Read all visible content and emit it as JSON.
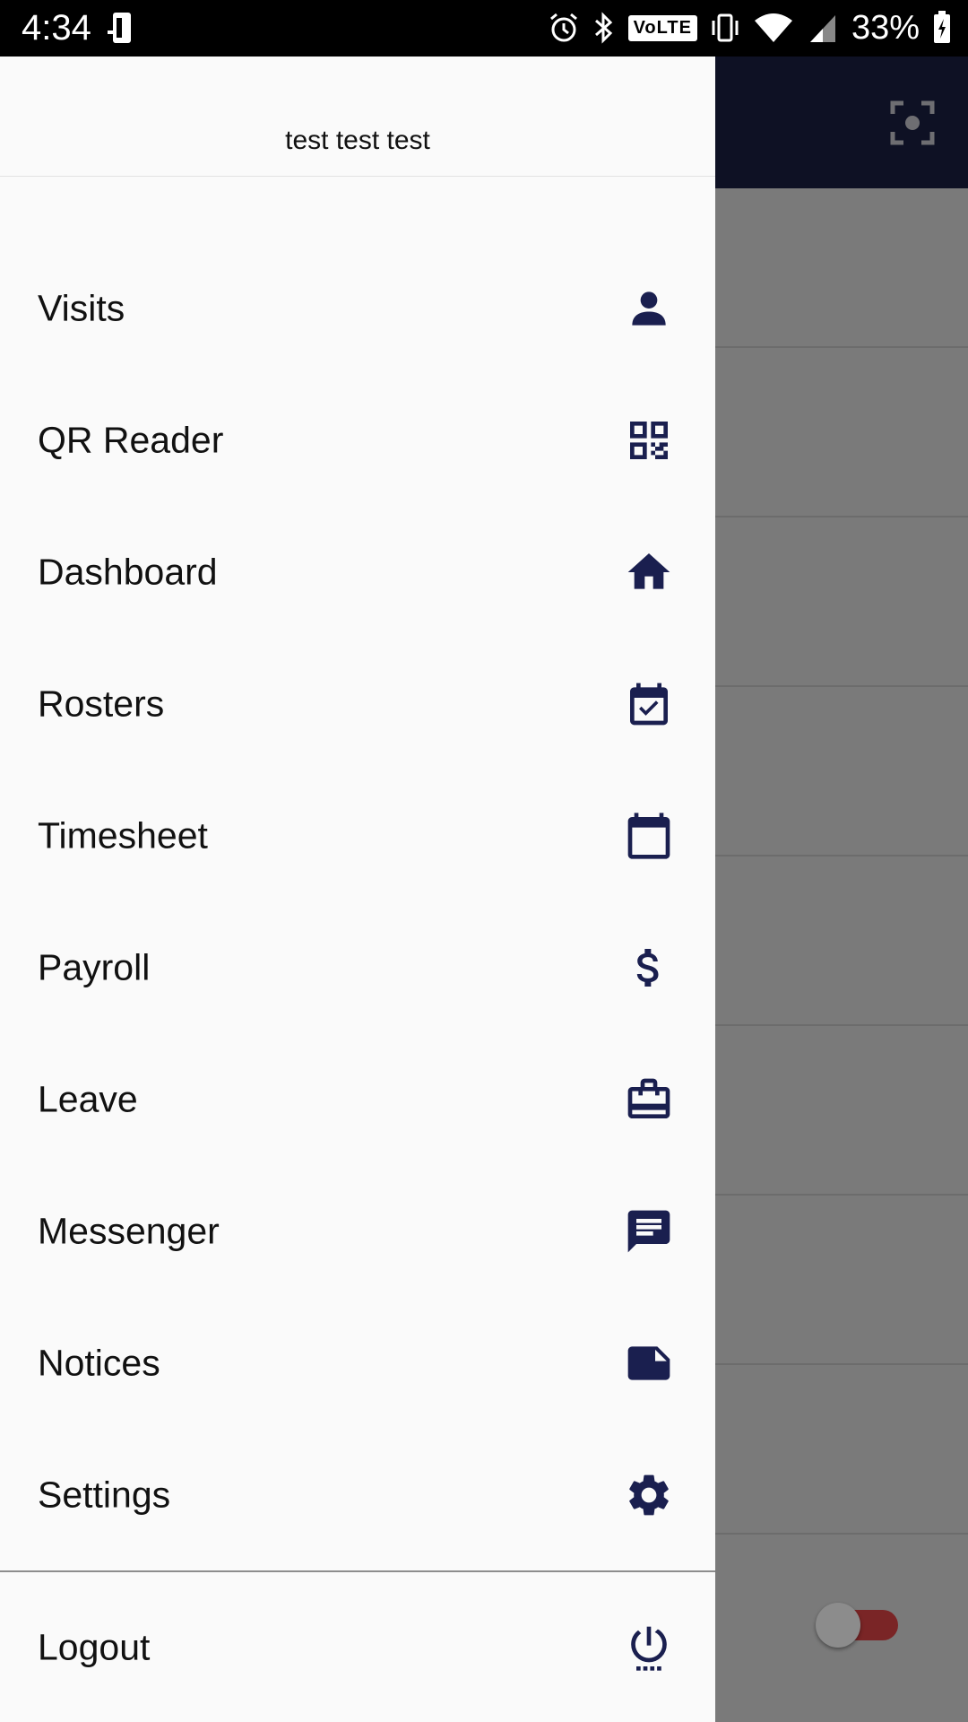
{
  "status_bar": {
    "time": "4:34",
    "volte": "VoLTE",
    "battery": "33%"
  },
  "drawer": {
    "user_name": "test test test",
    "items": [
      {
        "label": "Visits",
        "icon": "person-icon"
      },
      {
        "label": "QR Reader",
        "icon": "qr-code-icon"
      },
      {
        "label": "Dashboard",
        "icon": "home-icon"
      },
      {
        "label": "Rosters",
        "icon": "calendar-check-icon"
      },
      {
        "label": "Timesheet",
        "icon": "calendar-icon"
      },
      {
        "label": "Payroll",
        "icon": "dollar-icon"
      },
      {
        "label": "Leave",
        "icon": "briefcase-icon"
      },
      {
        "label": "Messenger",
        "icon": "message-icon"
      },
      {
        "label": "Notices",
        "icon": "note-icon"
      },
      {
        "label": "Settings",
        "icon": "gear-icon"
      }
    ],
    "logout": {
      "label": "Logout",
      "icon": "power-icon"
    }
  },
  "colors": {
    "accent": "#1a1f4f",
    "app_bar": "#0e1124",
    "toggle_track": "#7a2526"
  }
}
